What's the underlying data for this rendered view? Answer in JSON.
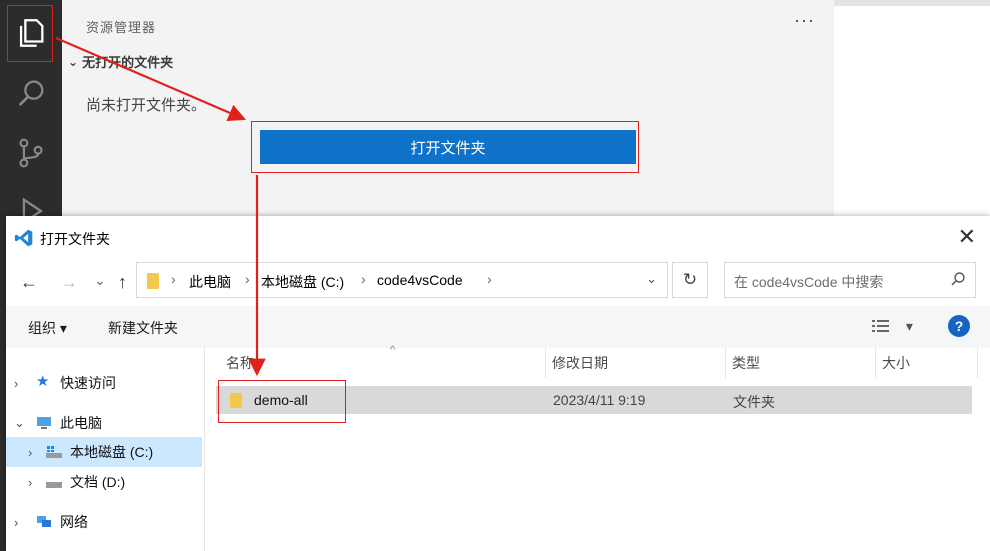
{
  "vscode": {
    "sidebar_title": "资源管理器",
    "more_label": "···",
    "section_title": "无打开的文件夹",
    "no_folder_message": "尚未打开文件夹。",
    "open_folder_button": "打开文件夹"
  },
  "dialog": {
    "title": "打开文件夹",
    "close_label": "✕",
    "nav": {
      "back": "←",
      "forward": "→",
      "recent": "⌄",
      "up": "↑"
    },
    "breadcrumb": [
      "此电脑",
      "本地磁盘 (C:)",
      "code4vsCode"
    ],
    "breadcrumb_sep": "›",
    "refresh_label": "↻",
    "search_placeholder": "在 code4vsCode 中搜索",
    "toolbar": {
      "organize": "组织 ▾",
      "new_folder": "新建文件夹",
      "view": "▾",
      "help": "?"
    },
    "nav_tree": [
      {
        "label": "快速访问",
        "expander": "›",
        "icon": "star-icon"
      },
      {
        "label": "此电脑",
        "expander": "⌄",
        "icon": "computer-icon"
      },
      {
        "label": "本地磁盘 (C:)",
        "expander": "›",
        "icon": "drive-c-icon",
        "selected": true
      },
      {
        "label": "文档 (D:)",
        "expander": "›",
        "icon": "drive-d-icon"
      },
      {
        "label": "网络",
        "expander": "›",
        "icon": "network-icon"
      }
    ],
    "columns": [
      "名称",
      "修改日期",
      "类型",
      "大小"
    ],
    "sort_indicator": "^",
    "files": [
      {
        "name": "demo-all",
        "modified": "2023/4/11 9:19",
        "type": "文件夹",
        "size": ""
      }
    ]
  },
  "annotation_color": "#e0201a"
}
